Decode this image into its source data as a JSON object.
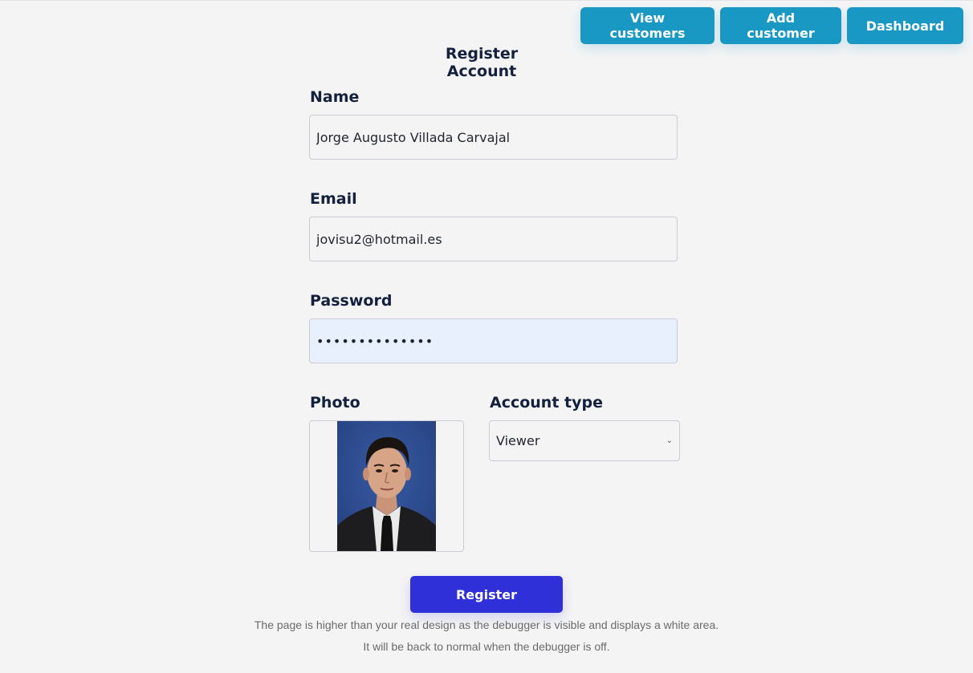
{
  "nav": {
    "view_customers": "View customers",
    "add_customer": "Add customer",
    "dashboard": "Dashboard"
  },
  "form": {
    "title": "Register Account",
    "name_label": "Name",
    "name_value": "Jorge Augusto Villada Carvajal",
    "email_label": "Email",
    "email_value": "jovisu2@hotmail.es",
    "password_label": "Password",
    "password_value": "••••••••••••••",
    "photo_label": "Photo",
    "account_type_label": "Account type",
    "account_type_value": "Viewer",
    "register_label": "Register"
  },
  "notes": {
    "line1": "The page is higher than your real design as the debugger is visible and displays a white area.",
    "line2": "It will be back to normal when the debugger is off."
  },
  "colors": {
    "nav_button": "#1a98c4",
    "register_button": "#3030d9",
    "heading": "#13213f",
    "background": "#f4f4f5",
    "autofill": "#e8f0fe"
  },
  "icons": {
    "select_chevron": "chevron-down-icon"
  }
}
